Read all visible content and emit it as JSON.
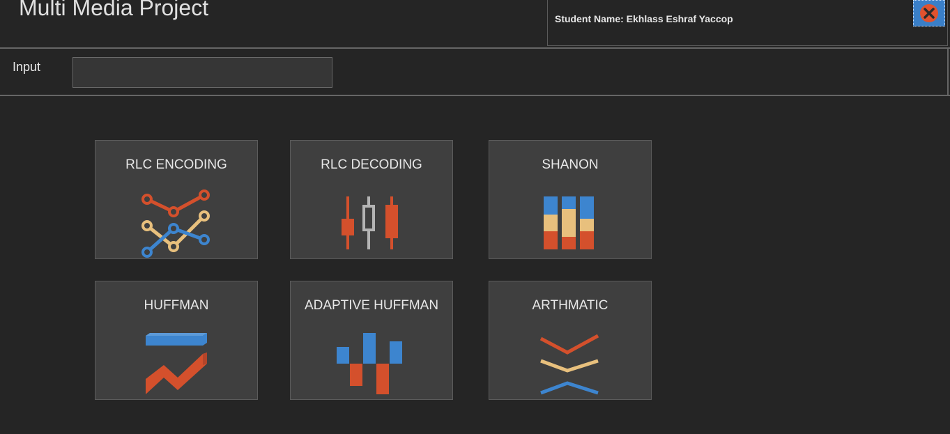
{
  "app": {
    "title": "Multi Media Project"
  },
  "header": {
    "student_label": "Student Name: Ekhlass Eshraf Yaccop",
    "close_icon": "close-circle-icon"
  },
  "input": {
    "label": "Input",
    "value": "",
    "placeholder": ""
  },
  "tiles": [
    {
      "label": "RLC ENCODING",
      "icon": "line-chart-icon"
    },
    {
      "label": "RLC DECODING",
      "icon": "candlestick-chart-icon"
    },
    {
      "label": "SHANON",
      "icon": "stacked-bar-chart-icon"
    },
    {
      "label": "HUFFMAN",
      "icon": "3d-area-chart-icon"
    },
    {
      "label": "ADAPTIVE HUFFMAN",
      "icon": "waterfall-chart-icon"
    },
    {
      "label": "ARTHMATIC",
      "icon": "chevron-lines-icon"
    }
  ],
  "colors": {
    "orange": "#d4502c",
    "yellow": "#e8c07d",
    "blue": "#3d85cf",
    "gray": "#b4b4b4"
  }
}
